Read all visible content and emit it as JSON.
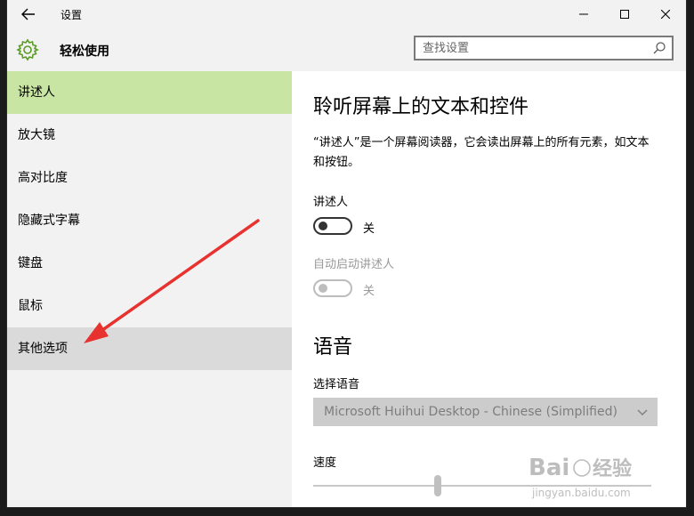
{
  "window": {
    "title": "设置"
  },
  "header": {
    "title": "轻松使用",
    "search_placeholder": "查找设置"
  },
  "icons": {
    "back": "back-arrow-icon",
    "gear": "gear-icon",
    "search": "search-icon",
    "minimize": "minimize-icon",
    "maximize": "maximize-icon",
    "close": "close-icon",
    "chevron": "chevron-down-icon"
  },
  "colors": {
    "accent": "#5a9d22",
    "selected_bg": "#c9e5a4",
    "arrow": "#e8322f"
  },
  "sidebar": {
    "items": [
      {
        "label": "讲述人",
        "state": "selected"
      },
      {
        "label": "放大镜",
        "state": "normal"
      },
      {
        "label": "高对比度",
        "state": "normal"
      },
      {
        "label": "隐藏式字幕",
        "state": "normal"
      },
      {
        "label": "键盘",
        "state": "normal"
      },
      {
        "label": "鼠标",
        "state": "normal"
      },
      {
        "label": "其他选项",
        "state": "hover"
      }
    ]
  },
  "main": {
    "heading": "聆听屏幕上的文本和控件",
    "description": "“讲述人”是一个屏幕阅读器，它会读出屏幕上的所有元素，如文本和按钮。",
    "narrator_label": "讲述人",
    "narrator_toggle_state": "关",
    "autostart_label": "自动启动讲述人",
    "autostart_toggle_state": "关",
    "voice_heading": "语音",
    "select_voice_label": "选择语音",
    "voice_value": "Microsoft Huihui Desktop - Chinese (Simplified)",
    "speed_label": "速度"
  },
  "watermark": {
    "text": "Baidu经验",
    "url": "jingyan.baidu.com"
  }
}
